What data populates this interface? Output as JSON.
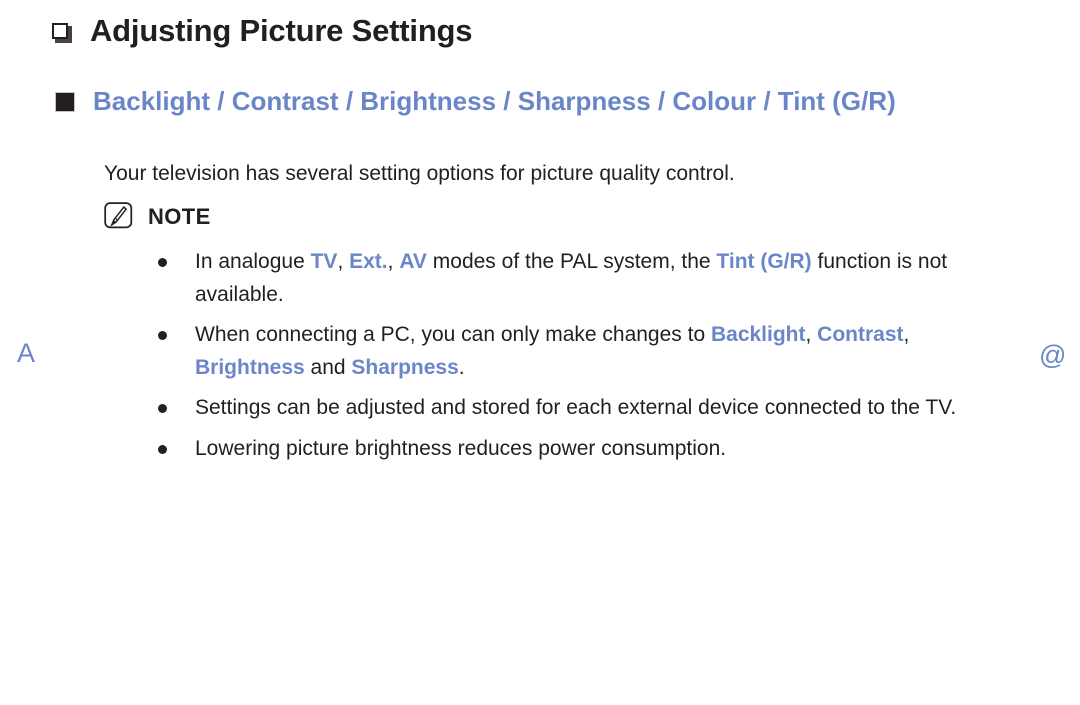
{
  "colors": {
    "accent_blue": "#6b86c8",
    "text_dark": "#231f20",
    "background": "#ffffff"
  },
  "title": {
    "bullet_icon": "hollow-square-bullet-icon",
    "text": "Adjusting Picture Settings"
  },
  "heading": {
    "bullet_icon": "filled-square-bullet-icon",
    "text": "Backlight / Contrast / Brightness / Sharpness / Colour / Tint (G/R)"
  },
  "body": {
    "paragraph": "Your television has several setting options for picture quality control."
  },
  "note": {
    "icon": "note-pencil-icon",
    "label": "NOTE",
    "items": [
      {
        "bullet_icon": "round-bullet-icon",
        "segments": [
          {
            "text": "In analogue ",
            "style": "normal"
          },
          {
            "text": "TV",
            "style": "keyword"
          },
          {
            "text": ", ",
            "style": "normal"
          },
          {
            "text": "Ext.",
            "style": "keyword"
          },
          {
            "text": ", ",
            "style": "normal"
          },
          {
            "text": "AV",
            "style": "keyword"
          },
          {
            "text": " modes of the PAL system, the ",
            "style": "normal"
          },
          {
            "text": "Tint (G/R)",
            "style": "keyword"
          },
          {
            "text": " function is not available.",
            "style": "normal"
          }
        ]
      },
      {
        "bullet_icon": "round-bullet-icon",
        "segments": [
          {
            "text": "When connecting a PC, you can only make changes to ",
            "style": "normal"
          },
          {
            "text": "Backlight",
            "style": "keyword"
          },
          {
            "text": ", ",
            "style": "normal"
          },
          {
            "text": "Contrast",
            "style": "keyword"
          },
          {
            "text": ", ",
            "style": "normal"
          },
          {
            "text": "Brightness",
            "style": "keyword"
          },
          {
            "text": " and ",
            "style": "normal"
          },
          {
            "text": "Sharpness",
            "style": "keyword"
          },
          {
            "text": ".",
            "style": "normal"
          }
        ]
      },
      {
        "bullet_icon": "round-bullet-icon",
        "segments": [
          {
            "text": "Settings can be adjusted and stored for each external device connected to the TV.",
            "style": "normal"
          }
        ]
      },
      {
        "bullet_icon": "round-bullet-icon",
        "segments": [
          {
            "text": "Lowering picture brightness reduces power consumption.",
            "style": "normal"
          }
        ]
      }
    ]
  },
  "margin_marks": {
    "left": "A",
    "right": "@"
  }
}
